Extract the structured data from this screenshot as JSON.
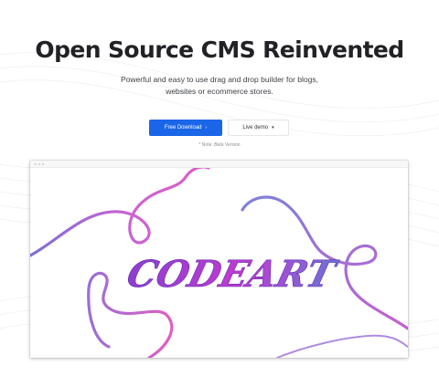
{
  "hero": {
    "title": "Open Source CMS Reinvented",
    "subtitle_line1": "Powerful and easy to use drag and drop builder for blogs,",
    "subtitle_line2": "websites or ecommerce stores."
  },
  "actions": {
    "primary_label": "Free Download",
    "primary_icon": "chevron-right-icon",
    "secondary_label": "Live demo",
    "secondary_icon": "chevron-down-icon"
  },
  "note": {
    "prefix": "* Note:",
    "emphasis": "Beta",
    "suffix": "Version"
  },
  "preview": {
    "logo_text": "CODEART"
  },
  "colors": {
    "primary": "#1a66e8",
    "swirl_pink": "#e25bc8",
    "swirl_purple": "#8a7fd6",
    "title": "#222226"
  }
}
